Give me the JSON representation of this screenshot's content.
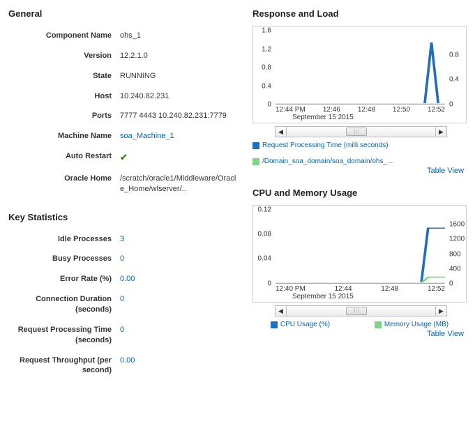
{
  "sections": {
    "general_title": "General",
    "keystats_title": "Key Statistics",
    "response_title": "Response and Load",
    "cpu_title": "CPU and Memory Usage"
  },
  "general": {
    "component_name_label": "Component Name",
    "component_name_value": "ohs_1",
    "version_label": "Version",
    "version_value": "12.2.1.0",
    "state_label": "State",
    "state_value": "RUNNING",
    "host_label": "Host",
    "host_value": "10.240.82.231",
    "ports_label": "Ports",
    "ports_value": "7777 4443 10.240.82.231:7779",
    "machine_label": "Machine Name",
    "machine_value": "soa_Machine_1",
    "auto_restart_label": "Auto Restart",
    "auto_restart_value": "✔",
    "oracle_home_label": "Oracle Home",
    "oracle_home_value": "/scratch/oracle1/Middleware/Oracle_Home/wlserver/.."
  },
  "keystats": {
    "idle_label": "Idle Processes",
    "idle_value": "3",
    "busy_label": "Busy Processes",
    "busy_value": "0",
    "error_label": "Error Rate (%)",
    "error_value": "0.00",
    "conn_label": "Connection Duration (seconds)",
    "conn_value": "0",
    "req_proc_label": "Request Processing Time (seconds)",
    "req_proc_value": "0",
    "throughput_label": "Request Throughput (per second)",
    "throughput_value": "0.00"
  },
  "chart_response": {
    "legend1": "Request Processing Time (milli seconds)",
    "legend1_color": "#1f6fbf",
    "legend2": "/Domain_soa_domain/soa_domain/ohs_...",
    "legend2_color": "#7fd48a",
    "table_view": "Table View",
    "date": "September 15 2015"
  },
  "chart_cpu": {
    "legend1": "CPU Usage (%)",
    "legend1_color": "#1f6fbf",
    "legend2": "Memory Usage (MB)",
    "legend2_color": "#7fd48a",
    "table_view": "Table View",
    "date": "September 15 2015"
  },
  "chart_data": [
    {
      "type": "line",
      "title": "Response and Load",
      "x_ticks": [
        "12:44 PM",
        "12:46",
        "12:48",
        "12:50",
        "12:52"
      ],
      "xlabel": "September 15 2015",
      "left_axis": {
        "label": "",
        "ticks": [
          0.0,
          0.4,
          0.8,
          1.2,
          1.6
        ],
        "range": [
          0.0,
          1.6
        ]
      },
      "right_axis": {
        "label": "",
        "ticks": [
          0.0,
          0.4,
          0.8
        ],
        "range": [
          0.0,
          0.8
        ]
      },
      "series": [
        {
          "name": "Request Processing Time (milli seconds)",
          "color": "#1f6fbf",
          "axis": "left",
          "x": [
            "12:44 PM",
            "12:45",
            "12:46",
            "12:47",
            "12:48",
            "12:49",
            "12:50",
            "12:51",
            "12:52",
            "12:52:30",
            "12:53"
          ],
          "y": [
            0,
            0,
            0,
            0,
            0,
            0,
            0,
            0,
            0,
            1.35,
            0
          ]
        },
        {
          "name": "/Domain_soa_domain/soa_domain/ohs_...",
          "color": "#7fd48a",
          "axis": "right",
          "x": [
            "12:44 PM",
            "12:46",
            "12:48",
            "12:50",
            "12:52",
            "12:53"
          ],
          "y": [
            0,
            0,
            0,
            0,
            0,
            0
          ]
        }
      ]
    },
    {
      "type": "line",
      "title": "CPU and Memory Usage",
      "x_ticks": [
        "12:40 PM",
        "12:44",
        "12:48",
        "12:52"
      ],
      "xlabel": "September 15 2015",
      "left_axis": {
        "label": "",
        "ticks": [
          0.0,
          0.04,
          0.08,
          0.12
        ],
        "range": [
          0.0,
          0.12
        ]
      },
      "right_axis": {
        "label": "",
        "ticks": [
          0,
          400,
          800,
          1200,
          1600
        ],
        "range": [
          0,
          1600
        ]
      },
      "series": [
        {
          "name": "CPU Usage (%)",
          "color": "#1f6fbf",
          "axis": "left",
          "x": [
            "12:40 PM",
            "12:44",
            "12:48",
            "12:52",
            "12:53",
            "12:54"
          ],
          "y": [
            0,
            0,
            0,
            0,
            0.09,
            0.09
          ]
        },
        {
          "name": "Memory Usage (MB)",
          "color": "#7fd48a",
          "axis": "right",
          "x": [
            "12:40 PM",
            "12:44",
            "12:48",
            "12:52",
            "12:53",
            "12:54"
          ],
          "y": [
            0,
            0,
            0,
            0,
            160,
            160
          ]
        }
      ]
    }
  ]
}
